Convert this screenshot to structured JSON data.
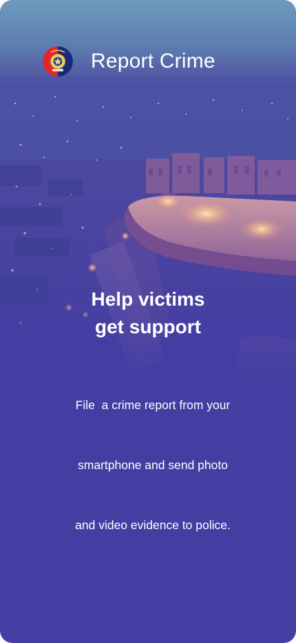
{
  "header": {
    "logo_icon": "police-emblem-icon",
    "title": "Report Crime"
  },
  "hero": {
    "headline_lines": [
      "Help victims",
      "get support"
    ],
    "description_lines": [
      "File  a crime report from your",
      "smartphone and send photo",
      "and video evidence to police."
    ]
  },
  "colors": {
    "background": "#433ea2",
    "text": "#ffffff",
    "logo_red": "#e3262b",
    "logo_blue": "#1b2a78"
  }
}
